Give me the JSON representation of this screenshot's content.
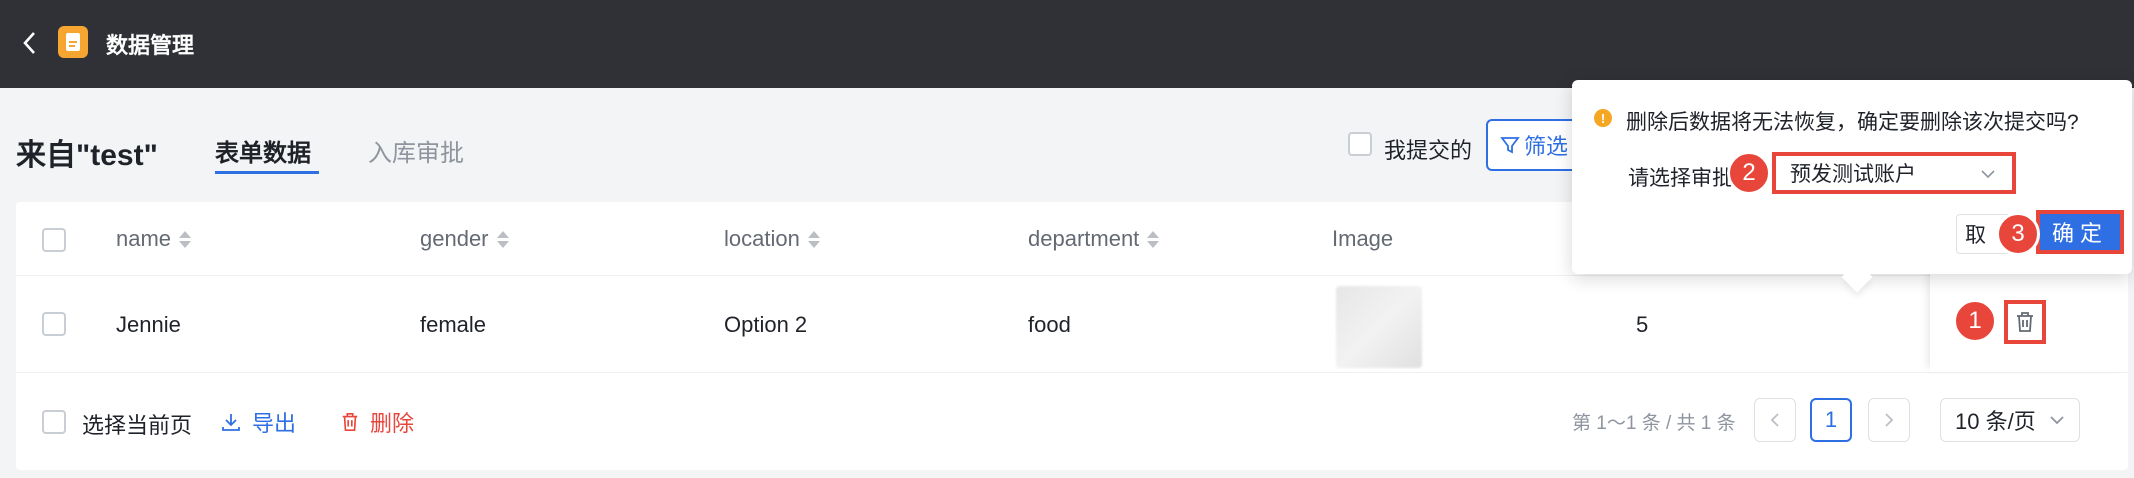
{
  "header": {
    "title": "数据管理",
    "back_icon": "chevron-left-icon",
    "app_icon": "document-icon"
  },
  "page": {
    "source_title": "来自\"test\"",
    "tabs": [
      {
        "label": "表单数据"
      },
      {
        "label": "入库审批"
      }
    ],
    "mine_label": "我提交的",
    "filter_label": "筛选"
  },
  "table": {
    "columns": [
      "name",
      "gender",
      "location",
      "department",
      "Image"
    ],
    "rows": [
      {
        "name": "Jennie",
        "gender": "female",
        "location": "Option 2",
        "department": "food",
        "extra": "5"
      }
    ]
  },
  "footer": {
    "select_page_label": "选择当前页",
    "export_label": "导出",
    "delete_label": "删除",
    "page_info": "第 1～1 条 / 共 1 条",
    "current_page": "1",
    "page_size": "10 条/页"
  },
  "popover": {
    "message": "删除后数据将无法恢复，确定要删除该次提交吗?",
    "select_label": "请选择审批",
    "select_value": "预发测试账户",
    "cancel_label": "取",
    "ok_label": "确定"
  },
  "annotations": {
    "step1": "1",
    "step2": "2",
    "step3": "3"
  },
  "colors": {
    "accent": "#2f6fe4",
    "danger": "#e8463b",
    "topbar": "#2f3136",
    "warning": "#f5a623"
  }
}
